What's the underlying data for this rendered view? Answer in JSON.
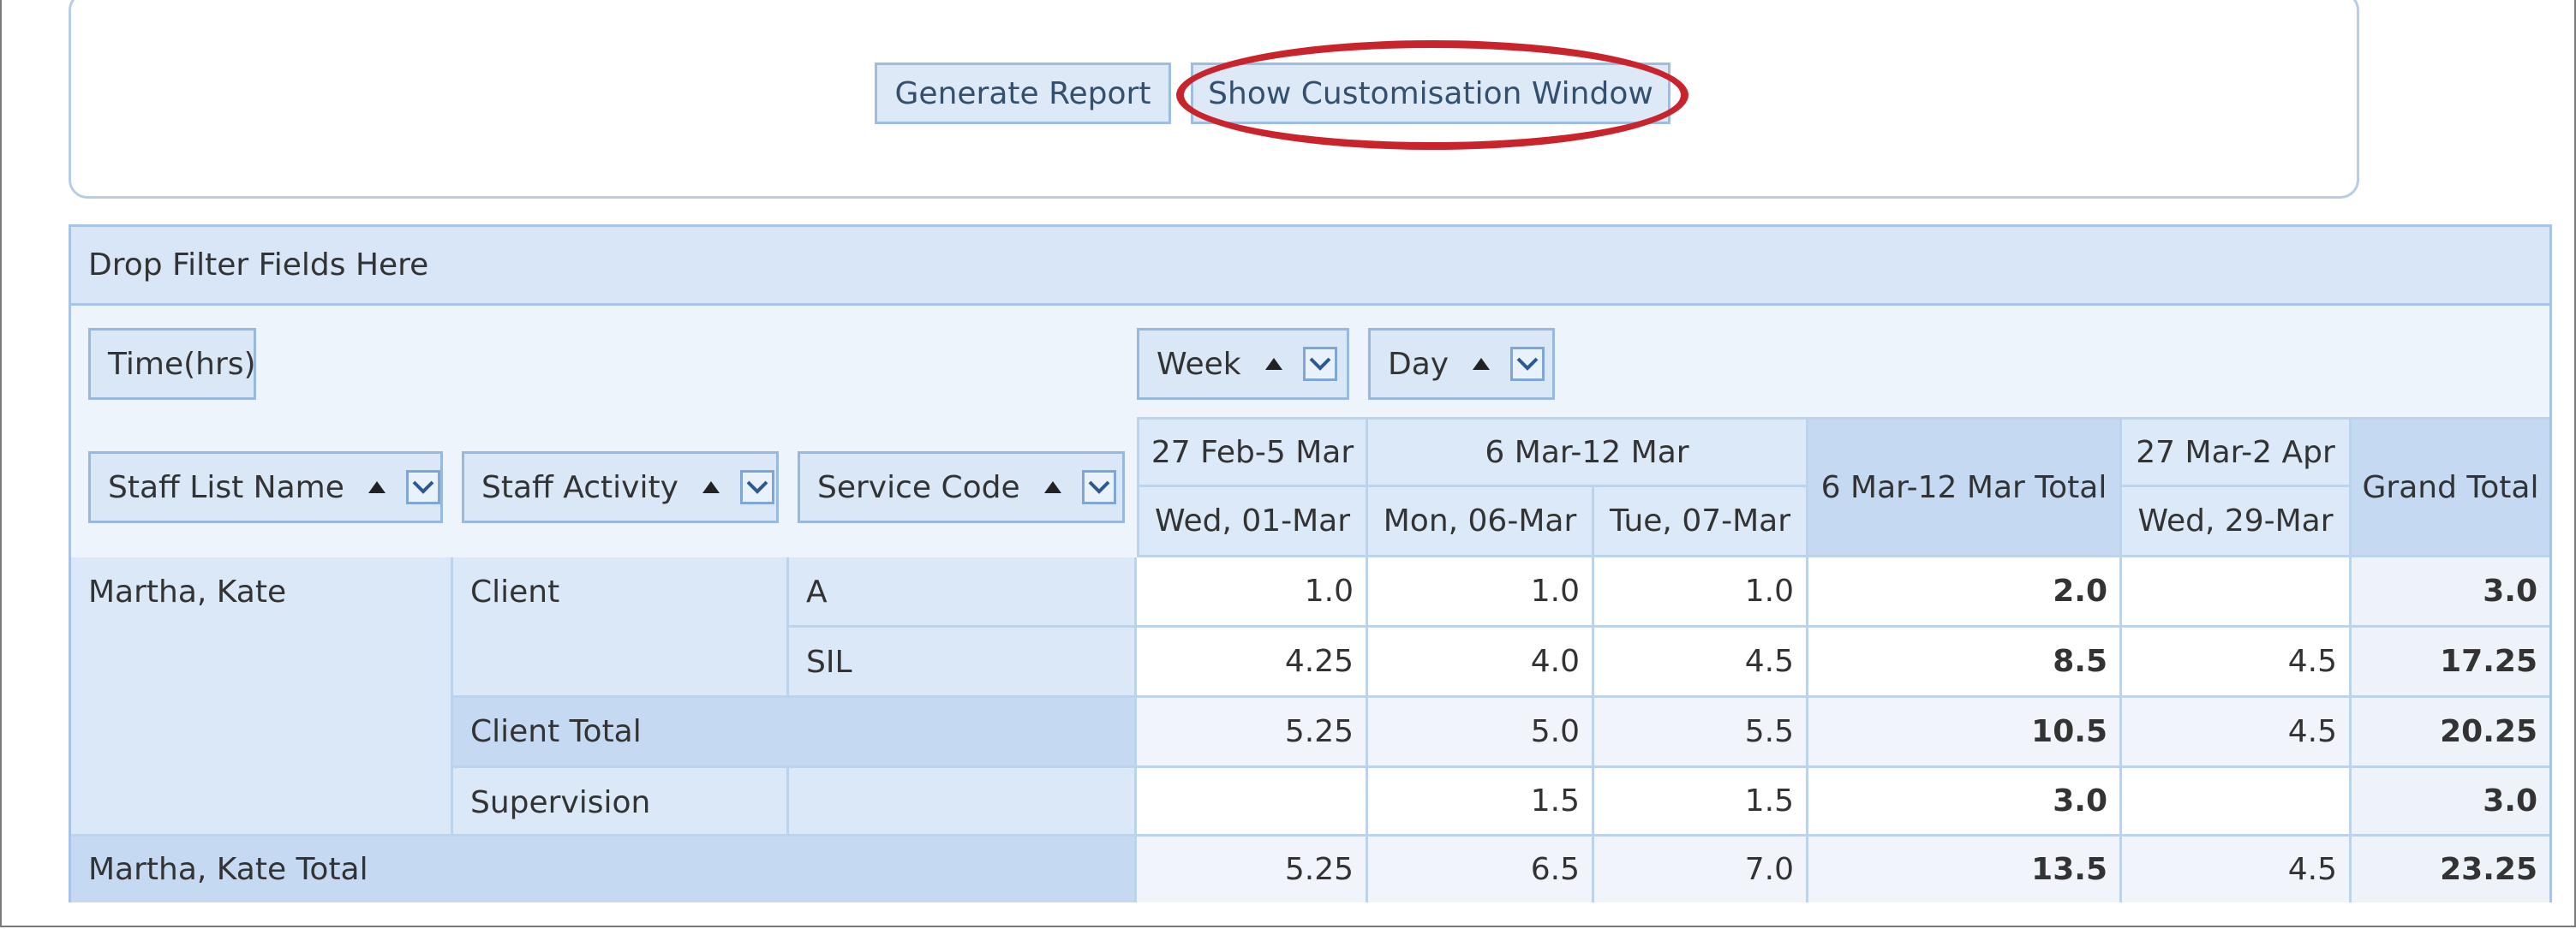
{
  "toolbar": {
    "generate_label": "Generate Report",
    "customise_label": "Show Customisation Window",
    "highlight_color": "#c9242b"
  },
  "pivot": {
    "filter_area": "Drop Filter Fields Here",
    "data_field": "Time(hrs)",
    "column_fields": [
      "Week",
      "Day"
    ],
    "row_fields": [
      "Staff List Name",
      "Staff Activity",
      "Service Code"
    ],
    "weeks": [
      "27 Feb-5 Mar",
      "6 Mar-12 Mar",
      "6 Mar-12 Mar Total",
      "27 Mar-2 Apr",
      "Grand Total"
    ],
    "days": [
      "Wed, 01-Mar",
      "Mon, 06-Mar",
      "Tue, 07-Mar",
      "Wed, 29-Mar"
    ],
    "rows": {
      "staff": "Martha, Kate",
      "activity_client": "Client",
      "code_a": "A",
      "code_sil": "SIL",
      "client_total": "Client Total",
      "supervision": "Supervision",
      "staff_total": "Martha, Kate Total"
    },
    "values": {
      "r1": [
        "1.0",
        "1.0",
        "1.0",
        "2.0",
        "",
        "3.0"
      ],
      "r2": [
        "4.25",
        "4.0",
        "4.5",
        "8.5",
        "4.5",
        "17.25"
      ],
      "r3": [
        "5.25",
        "5.0",
        "5.5",
        "10.5",
        "4.5",
        "20.25"
      ],
      "r4": [
        "",
        "1.5",
        "1.5",
        "3.0",
        "",
        "3.0"
      ],
      "r5": [
        "5.25",
        "6.5",
        "7.0",
        "13.5",
        "4.5",
        "23.25"
      ]
    }
  }
}
